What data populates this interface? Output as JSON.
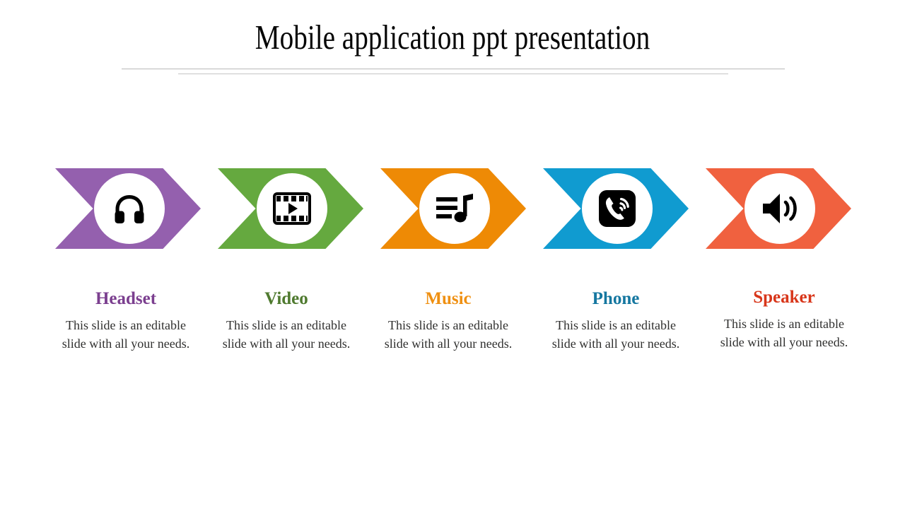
{
  "slide": {
    "title": "Mobile application ppt presentation",
    "background_color": "#ffffff",
    "divider_color": "#b9b9b9"
  },
  "items": [
    {
      "id": "headset",
      "label": "Headset",
      "body": "This slide is an editable slide with all your needs.",
      "color": "#9460ae",
      "heading_color": "#7b3f8f",
      "icon": "headphones-icon"
    },
    {
      "id": "video",
      "label": "Video",
      "body": "This slide is an editable slide with all your needs.",
      "color": "#65a93f",
      "heading_color": "#4f7a2f",
      "icon": "film-play-icon"
    },
    {
      "id": "music",
      "label": "Music",
      "body": "This slide is an editable slide with all your needs.",
      "color": "#ee8a05",
      "heading_color": "#ef9012",
      "icon": "music-playlist-icon"
    },
    {
      "id": "phone",
      "label": "Phone",
      "body": "This slide is an editable slide with all your needs.",
      "color": "#109bd0",
      "heading_color": "#1577a0",
      "icon": "phone-call-icon"
    },
    {
      "id": "speaker",
      "label": "Speaker",
      "body": "This slide is an editable slide with all your needs.",
      "color": "#f0613f",
      "heading_color": "#d8361a",
      "icon": "speaker-volume-icon"
    }
  ]
}
